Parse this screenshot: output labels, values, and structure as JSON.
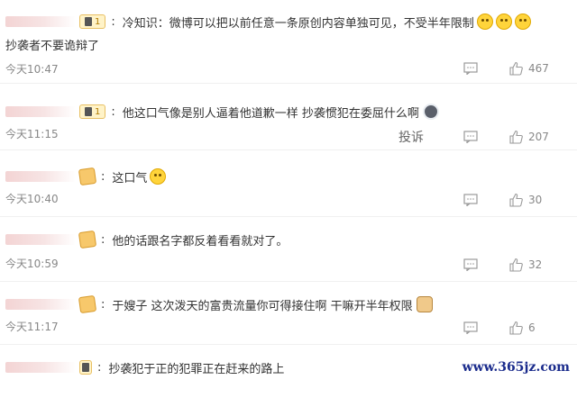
{
  "comments": [
    {
      "badge": "1",
      "text": "冷知识：微博可以把以前任意一条原创内容单独可见，不受半年限制",
      "text_line2": "抄袭者不要诡辩了",
      "time": "今天10:47",
      "likes": "467",
      "emoji": [
        "smile-icon",
        "smile-icon",
        "smile-icon"
      ]
    },
    {
      "badge": "1",
      "text": "他这口气像是别人逼着他道歉一样 抄袭惯犯在委屈什么啊",
      "time": "今天11:15",
      "report": "投诉",
      "likes": "207",
      "emoji": [
        "husky-icon"
      ]
    },
    {
      "text": "这口气",
      "time": "今天10:40",
      "likes": "30",
      "emoji": [
        "smirk-icon"
      ]
    },
    {
      "text": "他的话跟名字都反着看看就对了。",
      "time": "今天10:59",
      "likes": "32"
    },
    {
      "text": "于嫂子 这次泼天的富贵流量你可得接住啊 干嘛开半年权限",
      "time": "今天11:17",
      "likes": "6",
      "emoji": [
        "doge-icon"
      ]
    },
    {
      "text": "抄袭犯于正的犯罪正在赶来的路上"
    }
  ],
  "watermark": "www.365jz.com"
}
